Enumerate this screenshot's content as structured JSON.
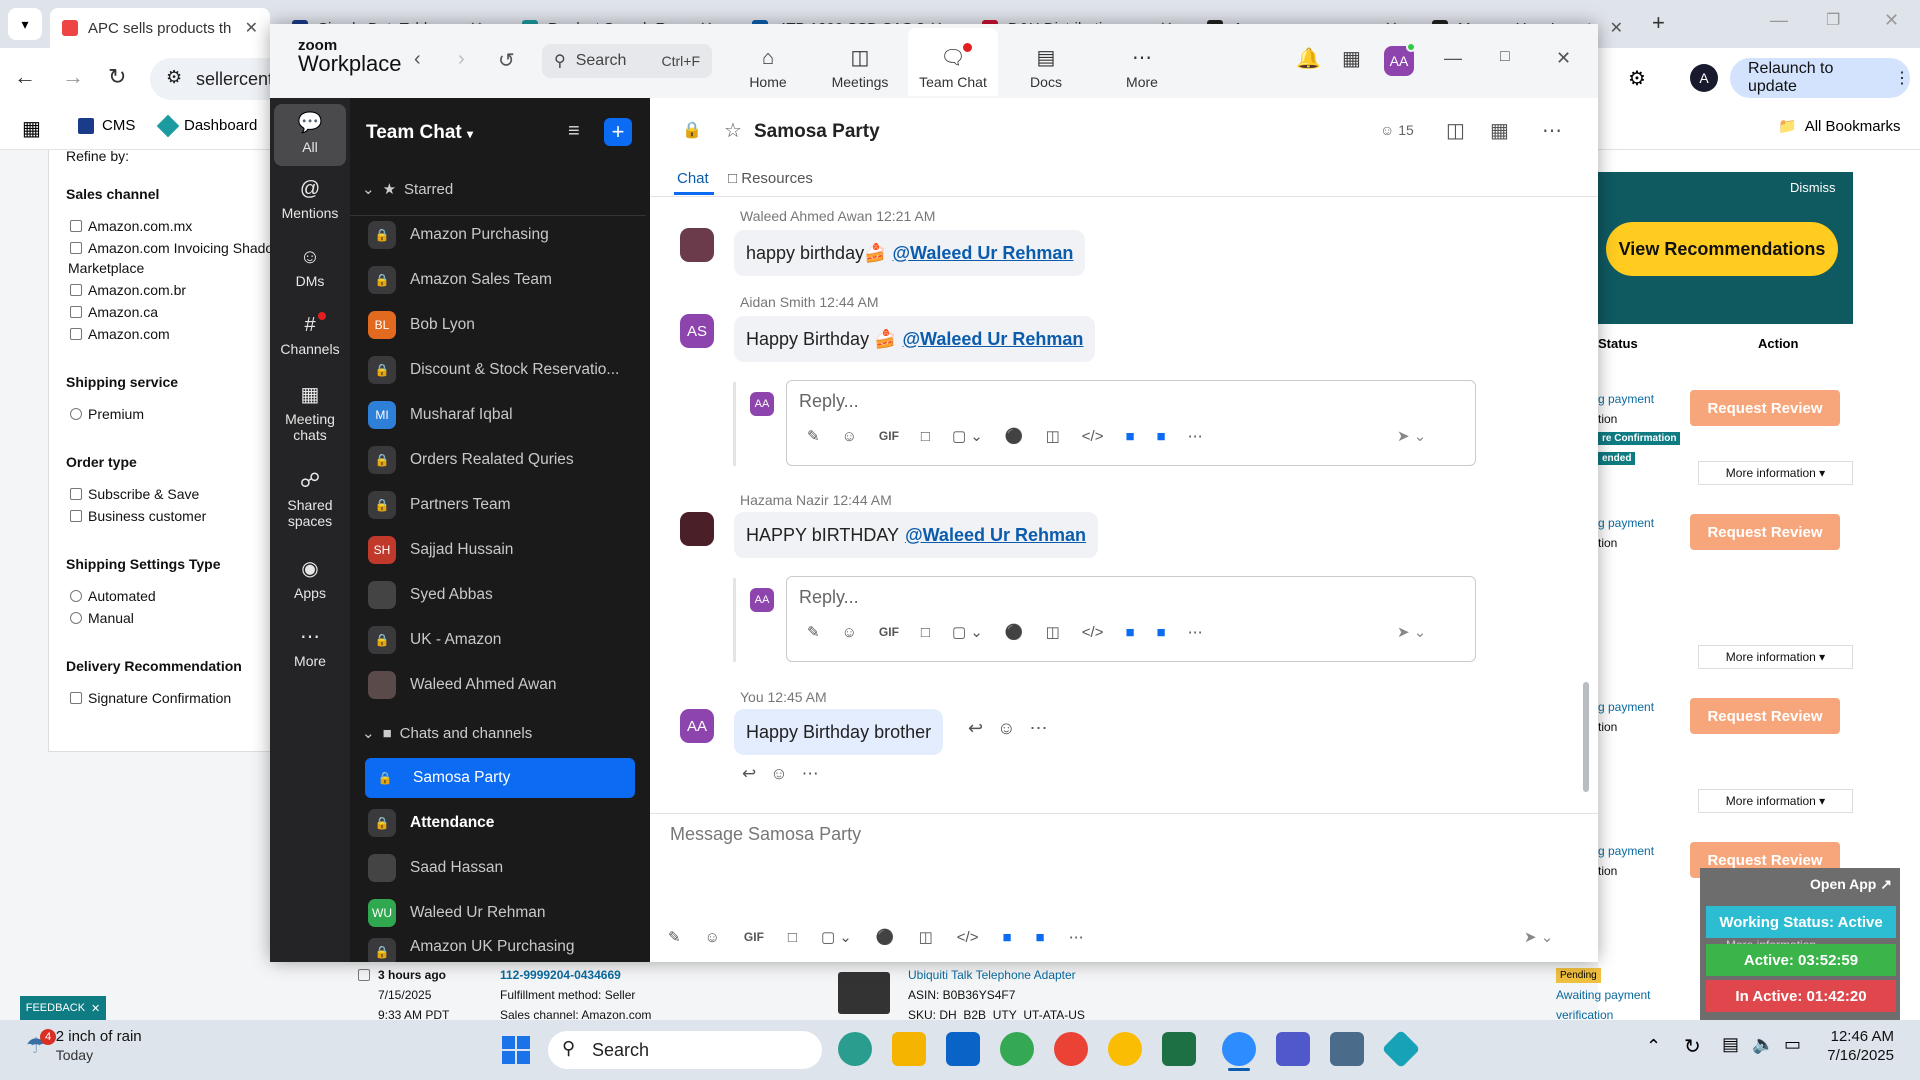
{
  "browser": {
    "tabs": [
      {
        "title": "APC sells products th",
        "color": "#e44"
      },
      {
        "title": "Simple DataTable",
        "color": "#1a3a8a"
      },
      {
        "title": "Product Search Resu",
        "color": "#1b9aa0"
      },
      {
        "title": "4TB 1200 SSD SAS 3",
        "color": "#0a5fb0"
      },
      {
        "title": "D&H Distribution",
        "color": "#c8102e"
      },
      {
        "title": "Amazon",
        "color": "#222"
      },
      {
        "title": "Manage Your Invent",
        "color": "#222"
      }
    ],
    "url": "sellercent",
    "relaunch_label": "Relaunch to update",
    "profile_initial": "A",
    "bookmarks": [
      "CMS",
      "Dashboard"
    ],
    "all_bookmarks": "All Bookmarks"
  },
  "seller": {
    "refine_title": "Refine by:",
    "sections": [
      {
        "title": "Sales channel",
        "type": "checkbox",
        "items": [
          "Amazon.com.mx",
          "Amazon.com Invoicing Shado",
          "Marketplace",
          "Amazon.com.br",
          "Amazon.ca",
          "Amazon.com"
        ]
      },
      {
        "title": "Shipping service",
        "type": "radio",
        "items": [
          "Premium"
        ]
      },
      {
        "title": "Order type",
        "type": "checkbox",
        "items": [
          "Subscribe & Save",
          "Business customer"
        ]
      },
      {
        "title": "Shipping Settings Type",
        "type": "radio",
        "items": [
          "Automated",
          "Manual"
        ]
      },
      {
        "title": "Delivery Recommendation",
        "type": "checkbox",
        "items": [
          "Signature Confirmation"
        ]
      }
    ],
    "dismiss": "Dismiss",
    "view_recommendations": "View Recommendations",
    "col_status": "Status",
    "col_action": "Action",
    "request_review": "Request Review",
    "more_information": "More information ▾",
    "payment_text": "g payment",
    "tion_text": "tion",
    "badge_confirmation": "re Confirmation",
    "badge_ended": "ended",
    "order": {
      "time": "3 hours ago",
      "date": "7/15/2025",
      "clock": "9:33 AM PDT",
      "order_id": "112-9999204-0434669",
      "fulfillment": "Fulfillment method: Seller",
      "channel": "Sales channel: Amazon.com",
      "product": "Ubiquiti Talk Telephone Adapter",
      "asin": "ASIN: B0B36YS4F7",
      "sku": "SKU: DH_B2B_UTY_UT-ATA-US",
      "status_badge": "Pending",
      "status_text": "Awaiting payment",
      "status_text2": "verification"
    },
    "feedback": "FEEDBACK",
    "open_app": "Open App ↗",
    "working_status": "Working Status: Active",
    "active_time": "Active: 03:52:59",
    "inactive_time": "In Active: 01:42:20",
    "more_info_small": "More information"
  },
  "zoom": {
    "logo_top": "zoom",
    "logo_bottom": "Workplace",
    "search_placeholder": "Search",
    "search_shortcut": "Ctrl+F",
    "nav": [
      {
        "label": "Home",
        "icon": "home-icon"
      },
      {
        "label": "Meetings",
        "icon": "video-icon"
      },
      {
        "label": "Team Chat",
        "icon": "chat-icon"
      },
      {
        "label": "Docs",
        "icon": "doc-icon"
      },
      {
        "label": "More",
        "icon": "more-icon"
      }
    ],
    "user_initials": "AA",
    "rail": [
      {
        "label": "All",
        "icon": "chat-bubble-icon"
      },
      {
        "label": "Mentions",
        "icon": "at-icon"
      },
      {
        "label": "DMs",
        "icon": "people-icon"
      },
      {
        "label": "Channels",
        "icon": "hash-icon"
      },
      {
        "label": "Meeting chats",
        "icon": "calendar-icon"
      },
      {
        "label": "Shared spaces",
        "icon": "share-icon"
      },
      {
        "label": "Apps",
        "icon": "apps-icon"
      },
      {
        "label": "More",
        "icon": "ellipsis-icon"
      }
    ],
    "panel_title": "Team Chat",
    "starred_label": "Starred",
    "starred": [
      {
        "name": "Amazon Purchasing",
        "type": "lock"
      },
      {
        "name": "Amazon Sales Team",
        "type": "lock"
      },
      {
        "name": "Bob Lyon",
        "type": "user",
        "initials": "BL",
        "color": "#e26a1f"
      },
      {
        "name": "Discount & Stock Reservatio...",
        "type": "lock"
      },
      {
        "name": "Musharaf Iqbal",
        "type": "user",
        "initials": "MI",
        "color": "#2d7fd8"
      },
      {
        "name": "Orders Realated Quries",
        "type": "lock"
      },
      {
        "name": "Partners Team",
        "type": "lock"
      },
      {
        "name": "Sajjad Hussain",
        "type": "user",
        "initials": "SH",
        "color": "#c0392b"
      },
      {
        "name": "Syed Abbas",
        "type": "user",
        "initials": "",
        "color": "#444"
      },
      {
        "name": "UK - Amazon",
        "type": "lock"
      },
      {
        "name": "Waleed Ahmed Awan",
        "type": "user",
        "initials": "",
        "color": "#5a4a4a"
      }
    ],
    "chats_label": "Chats and channels",
    "chats": [
      {
        "name": "Samosa Party",
        "type": "lock"
      },
      {
        "name": "Attendance",
        "type": "lock"
      },
      {
        "name": "Saad Hassan",
        "type": "user",
        "initials": "",
        "color": "#444"
      },
      {
        "name": "Waleed Ur Rehman",
        "type": "user",
        "initials": "WU",
        "color": "#2fa84f"
      },
      {
        "name": "Amazon UK Purchasing",
        "type": "lock"
      }
    ],
    "channel": {
      "name": "Samosa Party",
      "member_count": "15",
      "tab_chat": "Chat",
      "tab_resources": "Resources"
    },
    "messages": [
      {
        "sender": "Waleed Ahmed Awan",
        "time": "12:21 AM",
        "text": "happy birthday🍰",
        "mention": "@Waleed Ur Rehman",
        "initials": "",
        "color": "#6b3b4b"
      },
      {
        "sender": "Aidan Smith",
        "time": "12:44 AM",
        "text": "Happy Birthday 🍰",
        "mention": "@Waleed Ur Rehman",
        "initials": "AS",
        "color": "#8e44ad"
      },
      {
        "sender": "Hazama Nazir",
        "time": "12:44 AM",
        "text": "HAPPY bIRTHDAY",
        "mention": "@Waleed Ur Rehman",
        "initials": "",
        "color": "#4a1f28"
      },
      {
        "sender": "You",
        "time": "12:45 AM",
        "text": "Happy Birthday brother",
        "mention": "",
        "initials": "AA",
        "color": "#8e44ad"
      }
    ],
    "reply_placeholder": "Reply...",
    "composer_placeholder": "Message Samosa Party",
    "gif_label": "GIF"
  },
  "taskbar": {
    "weather_badge": "4",
    "weather": "2 inch of rain",
    "weather_sub": "Today",
    "search": "Search",
    "time": "12:46 AM",
    "date": "7/16/2025"
  }
}
